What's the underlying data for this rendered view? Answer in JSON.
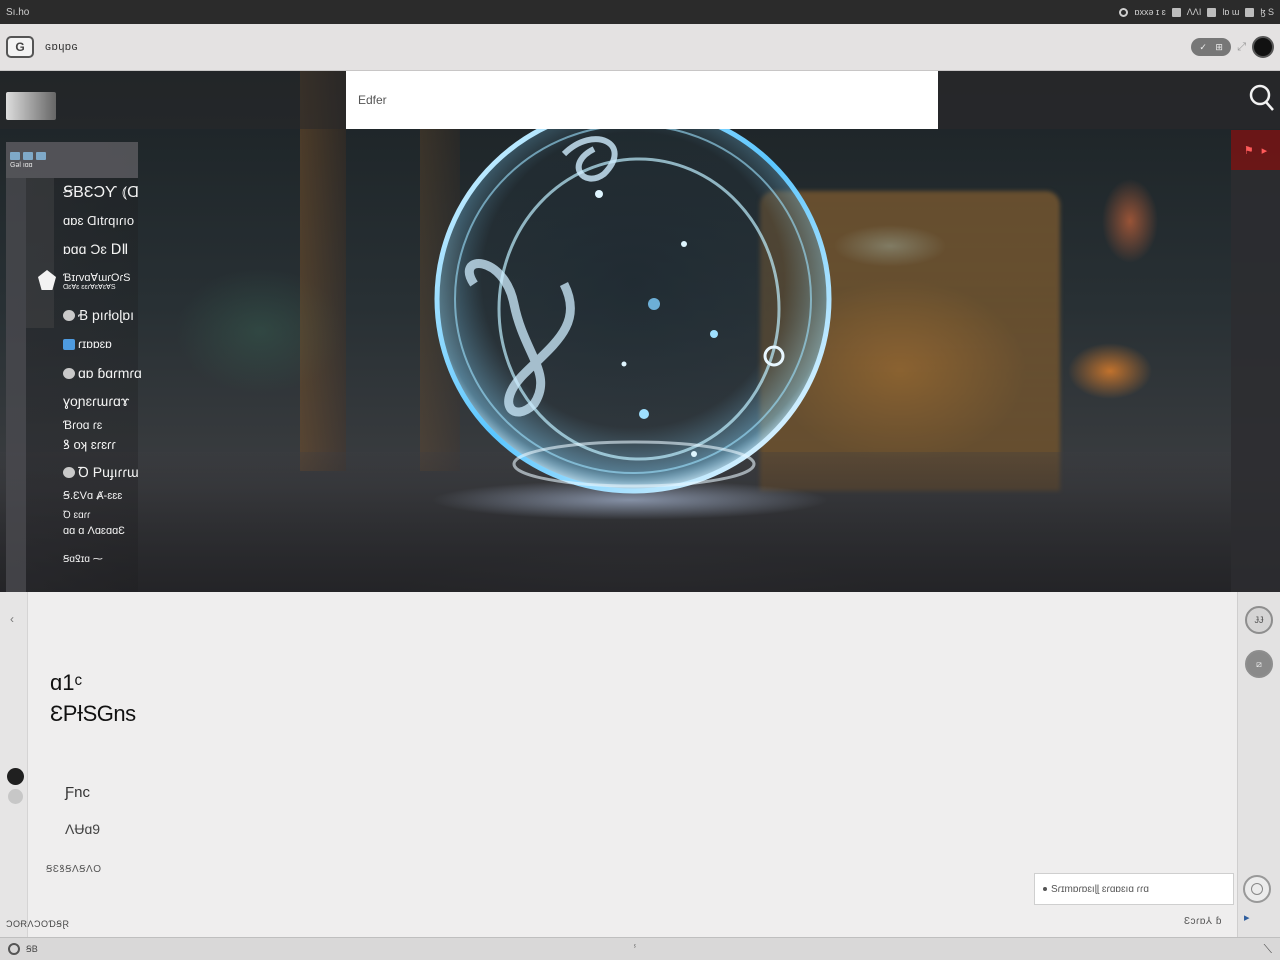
{
  "os_bar": {
    "left_label": "Sı.ho",
    "right_text": "ɒxxǝ ɪ ɛ",
    "right_text_2": "ɅΛΙ",
    "right_text_3": "lɒ ɯ",
    "right_text_4": "ɮ S"
  },
  "header": {
    "logo": "G",
    "title": "ɢɒɥɒɢ",
    "pill_left": "✓",
    "pill_right": "⊞"
  },
  "search": {
    "placeholder": "Edfer"
  },
  "side_menu": {
    "head_tiny": "Gəl  ıɑɑ",
    "items": [
      {
        "label": "ꞨBƐƆƳ ⦅Ɑ",
        "size": 16
      },
      {
        "label": "ɑɒɛ Ɑıtɾqıɾıo",
        "size": 13
      },
      {
        "label": "ɒɑɑ  Ɔɛ ⅮⅡ",
        "size": 14
      },
      {
        "label": "ƁɪɾvɑⱯɯɾOɾS",
        "size": 11
      },
      {
        "label": "ⱭɛⱯɛ ɛɛɾⱯɛⱯɛⱯS",
        "size": 7
      },
      {
        "label": "Ꞗ pıɾƚoɭɒı",
        "size": 14
      },
      {
        "label": "ɾɪɒɒɛɒ",
        "size": 12
      },
      {
        "label": "ɑɒ ɓɑɾmɾɑ",
        "size": 14
      },
      {
        "label": "ɣoɲɛɾɯɾɑɤ",
        "size": 14
      },
      {
        "label": "Ɓɾoɑ ɾɛ",
        "size": 12
      },
      {
        "label": "ꝸ oʞ ɛɾɛɾɾ",
        "size": 13
      },
      {
        "label": "Ꝺ Puɟıɾɾɯ",
        "size": 14
      },
      {
        "label": "Ꞩ.ƐVɑ Ⱥ-ɛɛɛ",
        "size": 11
      },
      {
        "label": "Ꝺ ɛɑɾɾ",
        "size": 10
      },
      {
        "label": "ɑɑ ɑ ɅɑɛɑɑƐ",
        "size": 11
      },
      {
        "label": "ꞨɑꝾɪɑ  ⁓",
        "size": 10
      }
    ]
  },
  "hero_right": {
    "red_tab_icon_1": "⚑",
    "red_tab_icon_2": "▸"
  },
  "lower": {
    "back": "‹",
    "title_1": "ɑ1ᶜ",
    "title_2": "ƐPƗSGns",
    "line_1": "Ƒnc",
    "line_2": "ɅɄɑ9",
    "footer_label": "ꞨƐꝸꞨɅꞨɅO",
    "corner_label": "ƆOɌɅƆOƊꞨⱤ",
    "rail_btn_1": "ɈɈ",
    "rail_btn_2": "⧄",
    "chat_placeholder": "Sɾɪmɒɾɒɛıɭɭ ɛɾɑɒɛıɑ ɾɾɑ",
    "count": "Ɛɔɾɒ⅄ ɓ",
    "flag": "▸"
  },
  "status": {
    "left": "ꞨB",
    "center": "ⸯ",
    "right": "⟍"
  }
}
